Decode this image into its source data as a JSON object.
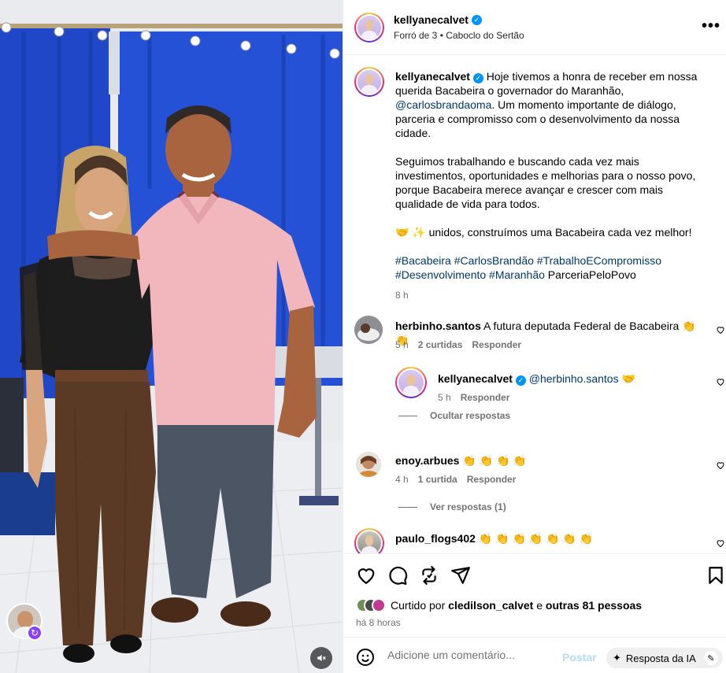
{
  "header": {
    "username": "kellyanecalvet",
    "subtitle": "Forró de 3 • Caboclo do Sertão",
    "more_label": "•••"
  },
  "caption": {
    "username": "kellyanecalvet",
    "text_part1": " Hoje tivemos a honra de receber em nossa querida Bacabeira o governador do Maranhão, ",
    "mention": "@carlosbrandaoma",
    "text_part2": ". Um momento importante de diálogo, parceria e compromisso com o desenvolvimento da nossa cidade.",
    "paragraph2": "Seguimos trabalhando e buscando cada vez mais investimentos, oportunidades e melhorias para o nosso povo, porque Bacabeira merece avançar e crescer com mais qualidade de vida para todos.",
    "paragraph3": "🤝 ✨ unidos, construímos uma Bacabeira cada vez melhor!",
    "hashtags": "#Bacabeira #CarlosBrandão #TrabalhoECompromisso #Desenvolvimento #Maranhão",
    "trailing": " ParceriaPeloPovo",
    "time": "8 h"
  },
  "comments": [
    {
      "username": "herbinho.santos",
      "text": " A futura deputada Federal de Bacabeira 👏 👏",
      "time": "5 h",
      "likes": "2 curtidas",
      "reply_label": "Responder"
    },
    {
      "username": "kellyanecalvet",
      "mention": "@herbinho.santos",
      "text": " 🤝",
      "time": "5 h",
      "reply_label": "Responder"
    },
    {
      "username": "enoy.arbues",
      "text": " 👏 👏 👏 👏",
      "time": "4 h",
      "likes": "1 curtida",
      "reply_label": "Responder"
    },
    {
      "username": "paulo_flogs402",
      "text": " 👏 👏 👏 👏 👏 👏 👏"
    }
  ],
  "threads": {
    "hide_replies": "Ocultar respostas",
    "view_replies": "Ver respostas (1)"
  },
  "likes": {
    "prefix": "Curtido por ",
    "user": "cledilson_calvet",
    "middle": " e ",
    "others": "outras 81 pessoas"
  },
  "post_time": "há 8 horas",
  "comment_box": {
    "placeholder": "Adicione um comentário...",
    "post_label": "Postar",
    "ai_label": "Resposta da IA"
  },
  "colors": {
    "link": "#00376b",
    "verified": "#0095f6",
    "muted": "#737373",
    "post_disabled": "#b3dbff"
  }
}
